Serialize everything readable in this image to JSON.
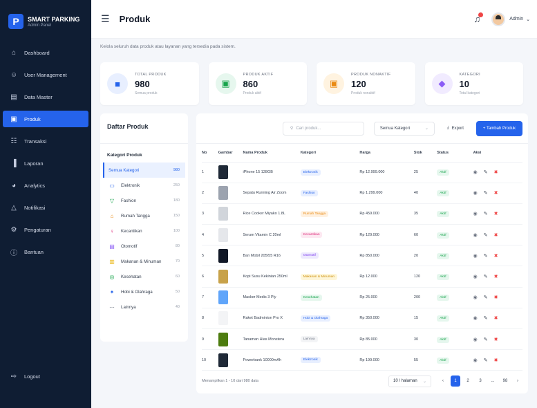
{
  "brand": {
    "name": "SMART PARKING",
    "sub": "Admin Panel",
    "logo": "P"
  },
  "nav": [
    {
      "label": "Dashboard",
      "icon": "home-icon"
    },
    {
      "label": "User Management",
      "icon": "users-icon"
    },
    {
      "label": "Data Master",
      "icon": "document-icon"
    },
    {
      "label": "Produk",
      "icon": "box-icon",
      "active": true
    },
    {
      "label": "Transaksi",
      "icon": "cart-icon"
    },
    {
      "label": "Laporan",
      "icon": "bar-chart-icon"
    },
    {
      "label": "Analytics",
      "icon": "pie-chart-icon"
    },
    {
      "label": "Notifikasi",
      "icon": "bell-icon"
    },
    {
      "label": "Pengaturan",
      "icon": "gear-icon"
    },
    {
      "label": "Bantuan",
      "icon": "help-icon"
    }
  ],
  "logout": "Logout",
  "header": {
    "title": "Produk",
    "user": "Admin"
  },
  "subtitle": "Kelola seluruh data produk atau layanan yang tersedia pada sistem.",
  "stats": [
    {
      "label": "TOTAL PRODUK",
      "value": "980",
      "sub": "Semua produk",
      "color": "#2563eb",
      "bg": "#e8efff",
      "icon": "■"
    },
    {
      "label": "PRODUK AKTIF",
      "value": "860",
      "sub": "Produk aktif",
      "color": "#16a34a",
      "bg": "#e6f7ee",
      "icon": "▣"
    },
    {
      "label": "PRODUK NONAKTIF",
      "value": "120",
      "sub": "Produk nonaktif",
      "color": "#ea8a12",
      "bg": "#fff3e0",
      "icon": "▣"
    },
    {
      "label": "KATEGORI",
      "value": "10",
      "sub": "Total kategori",
      "color": "#8b5cf6",
      "bg": "#f1ebff",
      "icon": "◆"
    }
  ],
  "left": {
    "title": "Daftar Produk",
    "subtitle": "Kategori Produk",
    "categories": [
      {
        "label": "Semua Kategori",
        "count": "980",
        "active": true,
        "icon": "",
        "color": "#2563eb"
      },
      {
        "label": "Elektronik",
        "count": "250",
        "icon": "▭",
        "color": "#2563eb"
      },
      {
        "label": "Fashion",
        "count": "180",
        "icon": "▽",
        "color": "#16a34a"
      },
      {
        "label": "Rumah Tangga",
        "count": "150",
        "icon": "⌂",
        "color": "#ea8a12"
      },
      {
        "label": "Kecantikan",
        "count": "100",
        "icon": "♀",
        "color": "#db2777"
      },
      {
        "label": "Otomotif",
        "count": "80",
        "icon": "▤",
        "color": "#8b5cf6"
      },
      {
        "label": "Makanan & Minuman",
        "count": "70",
        "icon": "▥",
        "color": "#eab308"
      },
      {
        "label": "Kesehatan",
        "count": "60",
        "icon": "◎",
        "color": "#16a34a"
      },
      {
        "label": "Hobi & Olahraga",
        "count": "50",
        "icon": "✦",
        "color": "#2563eb"
      },
      {
        "label": "Lainnya",
        "count": "40",
        "icon": "⋯",
        "color": "#6b7280"
      }
    ]
  },
  "toolbar": {
    "search_placeholder": "Cari produk...",
    "filter": "Semua Kategori",
    "export": "Export",
    "add": "+ Tambah Produk"
  },
  "table": {
    "headers": [
      "No",
      "Gambar",
      "Nama Produk",
      "Kategori",
      "Harga",
      "Stok",
      "Status",
      "Aksi"
    ],
    "rows": [
      {
        "no": "1",
        "name": "iPhone 15 128GB",
        "cat": "Elektronik",
        "price": "Rp 12.999.000",
        "stock": "25",
        "status": "Aktif",
        "catbg": "#e8efff",
        "catfg": "#2563eb",
        "thumb": "#1f2937"
      },
      {
        "no": "2",
        "name": "Sepatu Running Air Zoom",
        "cat": "Fashion",
        "price": "Rp 1.299.000",
        "stock": "40",
        "status": "Aktif",
        "catbg": "#e8efff",
        "catfg": "#2563eb",
        "thumb": "#9ca3af"
      },
      {
        "no": "3",
        "name": "Rice Cooker Miyako 1.8L",
        "cat": "Rumah Tangga",
        "price": "Rp 459.000",
        "stock": "35",
        "status": "Aktif",
        "catbg": "#fff1e0",
        "catfg": "#ea8a12",
        "thumb": "#d1d5db"
      },
      {
        "no": "4",
        "name": "Serum Vitamin C 20ml",
        "cat": "Kecantikan",
        "price": "Rp 129.000",
        "stock": "60",
        "status": "Aktif",
        "catbg": "#fde8f1",
        "catfg": "#db2777",
        "thumb": "#e5e7eb"
      },
      {
        "no": "5",
        "name": "Ban Mobil 205/55 R16",
        "cat": "Otomotif",
        "price": "Rp 850.000",
        "stock": "20",
        "status": "Aktif",
        "catbg": "#ede9fe",
        "catfg": "#7c3aed",
        "thumb": "#111827"
      },
      {
        "no": "6",
        "name": "Kopi Susu Kekinian 250ml",
        "cat": "Makanan & Minuman",
        "price": "Rp 12.000",
        "stock": "120",
        "status": "Aktif",
        "catbg": "#fef6d8",
        "catfg": "#ca8a04",
        "thumb": "#c8a24a"
      },
      {
        "no": "7",
        "name": "Masker Medis 3 Ply",
        "cat": "Kesehatan",
        "price": "Rp 25.000",
        "stock": "200",
        "status": "Aktif",
        "catbg": "#e6f7ee",
        "catfg": "#16a34a",
        "thumb": "#60a5fa"
      },
      {
        "no": "8",
        "name": "Raket Badminton Pro X",
        "cat": "Hobi & Olahraga",
        "price": "Rp 350.000",
        "stock": "15",
        "status": "Aktif",
        "catbg": "#e8efff",
        "catfg": "#2563eb",
        "thumb": "#f3f4f6"
      },
      {
        "no": "9",
        "name": "Tanaman Hias Monstera",
        "cat": "Lainnya",
        "price": "Rp 85.000",
        "stock": "30",
        "status": "Aktif",
        "catbg": "#f3f4f6",
        "catfg": "#6b7280",
        "thumb": "#4d7c0f"
      },
      {
        "no": "10",
        "name": "Powerbank 10000mAh",
        "cat": "Elektronik",
        "price": "Rp 199.000",
        "stock": "55",
        "status": "Aktif",
        "catbg": "#e8efff",
        "catfg": "#2563eb",
        "thumb": "#1f2937"
      }
    ]
  },
  "footer": {
    "showing": "Menampilkan 1 - 10 dari 980 data",
    "per_page": "10 / halaman",
    "pages": [
      "‹",
      "1",
      "2",
      "3",
      "...",
      "98",
      "›"
    ]
  }
}
